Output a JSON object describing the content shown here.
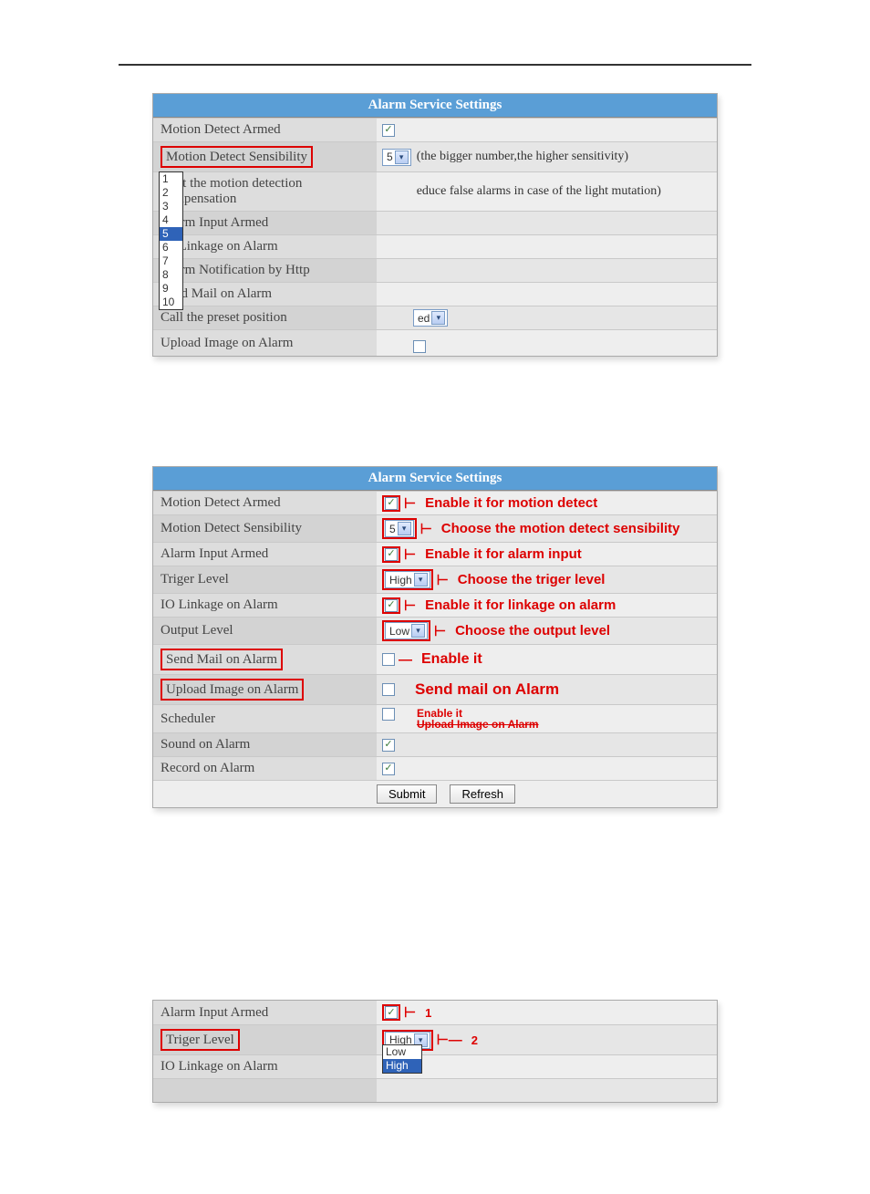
{
  "panel1": {
    "title": "Alarm Service Settings",
    "rows": [
      {
        "label": "Motion Detect Armed",
        "type": "checkbox",
        "checked": true
      },
      {
        "label": "Motion Detect Sensibility",
        "type": "select",
        "value": "5",
        "hint": "(the bigger number,the higher sensitivity)",
        "highlightLabel": true,
        "dropdownOpen": true
      },
      {
        "label": "Start the motion detection compensation",
        "type": "text",
        "hintAfterDropdown": "educe false alarms in case of the light mutation)"
      },
      {
        "label": "Alarm Input Armed",
        "type": "blank"
      },
      {
        "label": "IO Linkage on Alarm",
        "type": "blank"
      },
      {
        "label": "Alarm Notification by Http",
        "type": "blank"
      },
      {
        "label": "Send Mail on Alarm",
        "type": "blank"
      },
      {
        "label": "Call the preset position",
        "type": "select_partial",
        "partial": "ed"
      },
      {
        "label": "Upload Image on Alarm",
        "type": "checkbox_bottom"
      }
    ],
    "dropdownOptions": [
      "1",
      "2",
      "3",
      "4",
      "5",
      "6",
      "7",
      "8",
      "9",
      "10"
    ],
    "dropdownSelected": "5"
  },
  "panel2": {
    "title": "Alarm Service Settings",
    "rows": [
      {
        "label": "Motion Detect Armed",
        "ctrl": "checkbox",
        "checked": true,
        "boxed": true,
        "anno": "Enable it for motion detect"
      },
      {
        "label": "Motion Detect Sensibility",
        "ctrl": "select",
        "value": "5",
        "anno": "Choose the motion detect sensibility"
      },
      {
        "label": "Alarm Input Armed",
        "ctrl": "checkbox",
        "checked": true,
        "boxed": true,
        "anno": "Enable it for alarm input"
      },
      {
        "label": "Triger Level",
        "ctrl": "select",
        "value": "High",
        "anno": "Choose the triger level"
      },
      {
        "label": "IO Linkage on Alarm",
        "ctrl": "checkbox",
        "checked": true,
        "boxed": true,
        "anno": "Enable it for linkage on alarm"
      },
      {
        "label": "Output Level",
        "ctrl": "select",
        "value": "Low",
        "anno": "Choose the output level"
      },
      {
        "label": "Send Mail on Alarm",
        "ctrl": "checkbox",
        "checked": false,
        "highlightLabel": true,
        "anno": "Enable it",
        "annoBold": true
      },
      {
        "label": "Upload Image on Alarm",
        "ctrl": "checkbox",
        "checked": false,
        "highlightLabel": true,
        "anno": "Send mail on Alarm",
        "annoBig": true
      },
      {
        "label": "Scheduler",
        "ctrl": "checkbox",
        "checked": false,
        "annoStack": [
          "Enable it",
          "Upload Image on Alarm"
        ],
        "strikeSecond": true
      },
      {
        "label": "Sound on Alarm",
        "ctrl": "checkbox",
        "checked": true
      },
      {
        "label": "Record on Alarm",
        "ctrl": "checkbox",
        "checked": true
      }
    ],
    "buttons": {
      "submit": "Submit",
      "refresh": "Refresh"
    }
  },
  "panel3": {
    "rows": [
      {
        "label": "Alarm Input Armed",
        "ctrl": "checkbox",
        "checked": true,
        "boxed": true,
        "num": "1"
      },
      {
        "label": "Triger Level",
        "ctrl": "select",
        "value": "High",
        "highlightLabel": true,
        "num": "2",
        "dropdownOpen": true
      },
      {
        "label": "IO Linkage on Alarm",
        "ctrl": "blank"
      }
    ],
    "dropdownOptions": [
      "Low",
      "High"
    ],
    "dropdownSelected": "High"
  }
}
